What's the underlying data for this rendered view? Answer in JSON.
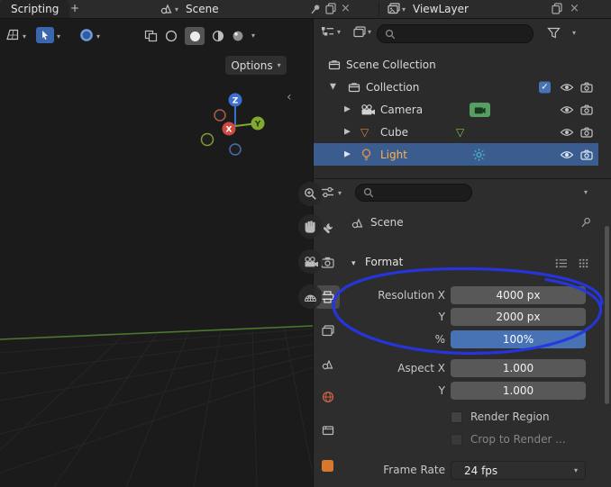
{
  "topbar": {
    "workspace_tab": "Scripting",
    "add_workspace": "+",
    "scene_name": "Scene",
    "viewlayer_name": "ViewLayer"
  },
  "viewport": {
    "options_button": "Options",
    "gizmo": {
      "x": "X",
      "y": "Y",
      "z": "Z"
    }
  },
  "outliner": {
    "rows": {
      "scene_collection": "Scene Collection",
      "collection": "Collection",
      "camera": "Camera",
      "cube": "Cube",
      "light": "Light"
    }
  },
  "properties": {
    "breadcrumb": "Scene",
    "format_section": "Format",
    "resolution_x_label": "Resolution X",
    "resolution_x_value": "4000 px",
    "resolution_y_label": "Y",
    "resolution_y_value": "2000 px",
    "resolution_pct_label": "%",
    "resolution_pct_value": "100%",
    "aspect_x_label": "Aspect X",
    "aspect_x_value": "1.000",
    "aspect_y_label": "Y",
    "aspect_y_value": "1.000",
    "render_region_label": "Render Region",
    "crop_label": "Crop to Render ...",
    "frame_rate_label": "Frame Rate",
    "frame_rate_value": "24 fps"
  },
  "icons": {
    "dropdown": "▾",
    "expand_open": "▼",
    "expand_closed": "▶",
    "close": "×",
    "check": "✓",
    "collapse_left": "‹",
    "mesh_triangle": "▽"
  },
  "colors": {
    "accent_blue": "#4772b3",
    "selection_row": "#3a5c8f",
    "annotation_blue": "#2536e4",
    "selected_light_text": "#ffb14d"
  }
}
